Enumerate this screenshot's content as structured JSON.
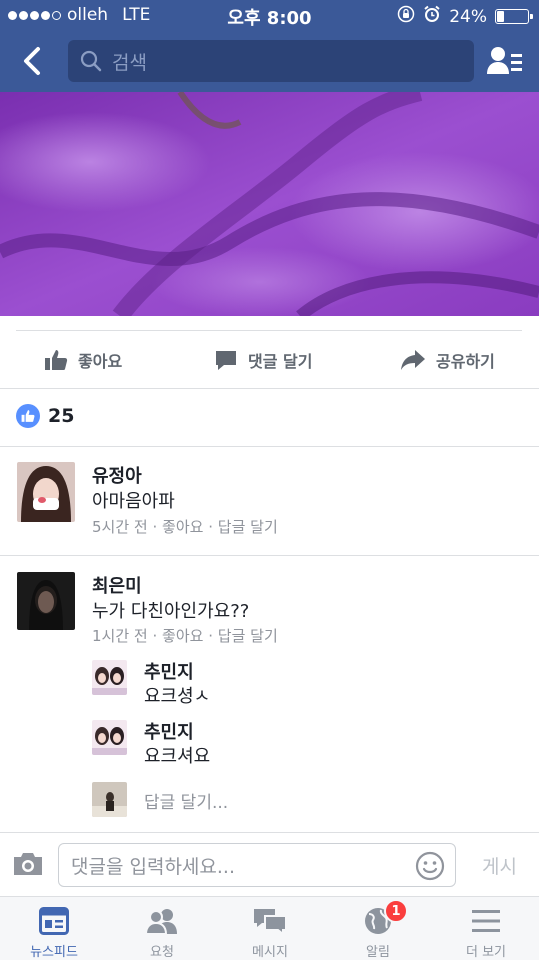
{
  "status_bar": {
    "carrier": "olleh",
    "network": "LTE",
    "time": "오후 8:00",
    "battery": "24%",
    "battery_level": 0.24,
    "signal_bars": 4
  },
  "nav": {
    "search_placeholder": "검색"
  },
  "actions": {
    "like": "좋아요",
    "comment": "댓글 달기",
    "share": "공유하기"
  },
  "likes": {
    "count": "25"
  },
  "comments": [
    {
      "name": "유정아",
      "text": "아마음아파",
      "time": "5시간 전",
      "like": "좋아요",
      "reply": "답글 달기"
    },
    {
      "name": "최은미",
      "text": "누가  다친아인가요??",
      "time": "1시간 전",
      "like": "좋아요",
      "reply": "답글 달기"
    }
  ],
  "replies": [
    {
      "name": "추민지",
      "text": "요크셩ㅅ"
    },
    {
      "name": "추민지",
      "text": "요크셔요"
    }
  ],
  "reply_placeholder": "답글 달기...",
  "composer": {
    "placeholder": "댓글을 입력하세요...",
    "post": "게시"
  },
  "tabs": [
    {
      "label": "뉴스피드",
      "icon": "news-feed-icon",
      "active": true
    },
    {
      "label": "요청",
      "icon": "friend-requests-icon"
    },
    {
      "label": "메시지",
      "icon": "messages-icon"
    },
    {
      "label": "알림",
      "icon": "globe-icon",
      "badge": "1"
    },
    {
      "label": "더 보기",
      "icon": "menu-icon"
    }
  ],
  "colors": {
    "brand": "#3b5998",
    "search_bg": "#2c4377",
    "like_blue": "#5890ff",
    "active_tab": "#4267b2",
    "badge_red": "#fa3e3e",
    "photo_purple": "#8e3fc2"
  }
}
